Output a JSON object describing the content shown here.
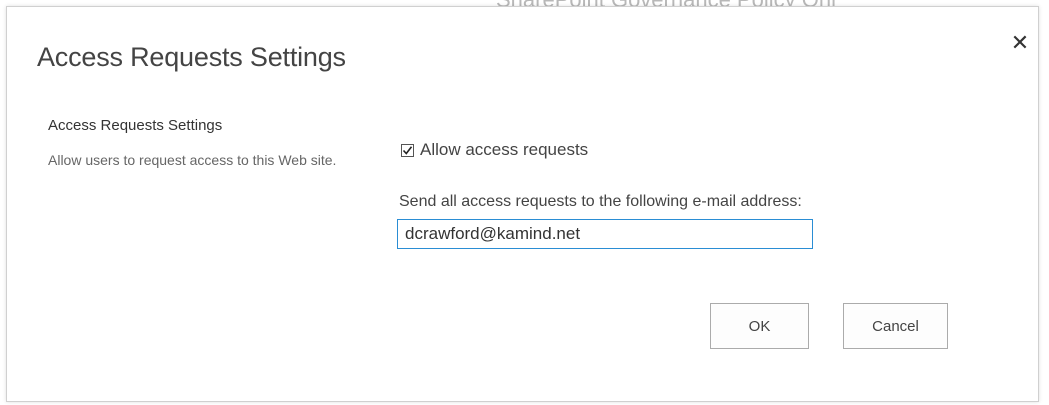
{
  "background_partial_title": "SharePoint Governance Policy Onl",
  "dialog": {
    "title": "Access Requests Settings",
    "close_glyph": "✕"
  },
  "section": {
    "heading": "Access Requests Settings",
    "description": "Allow users to request access to this Web site."
  },
  "allow_requests": {
    "label": "Allow access requests",
    "checked": true
  },
  "email": {
    "label": "Send all access requests to the following e-mail address:",
    "value": "dcrawford@kamind.net"
  },
  "buttons": {
    "ok_label": "OK",
    "cancel_label": "Cancel"
  },
  "colors": {
    "input_focus_border": "#2a8dd4",
    "button_border": "#ababab",
    "title_text": "#444444"
  },
  "icons": {
    "close": "close-icon",
    "check": "checkmark-icon"
  }
}
